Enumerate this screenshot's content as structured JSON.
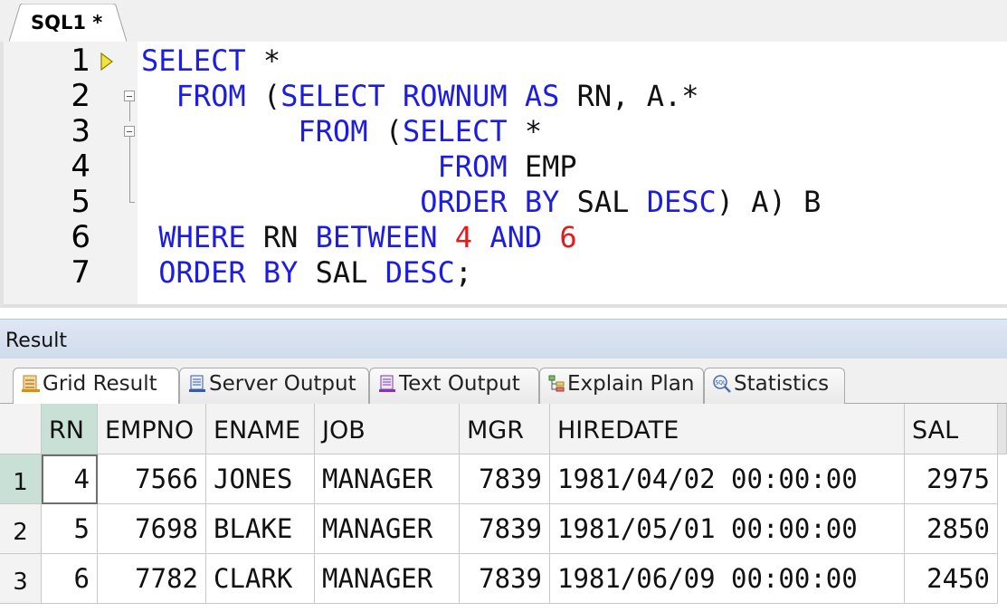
{
  "editor_tab": {
    "label": "SQL1 *"
  },
  "editor": {
    "line_numbers": [
      "1",
      "2",
      "3",
      "4",
      "5",
      "6",
      "7"
    ],
    "lines": [
      [
        {
          "t": "SELECT",
          "c": "kw"
        },
        {
          "t": " *",
          "c": "plain"
        }
      ],
      [
        {
          "t": "  FROM",
          "c": "kw"
        },
        {
          "t": " (",
          "c": "plain"
        },
        {
          "t": "SELECT ROWNUM AS",
          "c": "kw"
        },
        {
          "t": " RN, A.*",
          "c": "plain"
        }
      ],
      [
        {
          "t": "         FROM",
          "c": "kw"
        },
        {
          "t": " (",
          "c": "plain"
        },
        {
          "t": "SELECT",
          "c": "kw"
        },
        {
          "t": " *",
          "c": "plain"
        }
      ],
      [
        {
          "t": "                 FROM",
          "c": "kw"
        },
        {
          "t": " EMP",
          "c": "plain"
        }
      ],
      [
        {
          "t": "                ORDER BY",
          "c": "kw"
        },
        {
          "t": " SAL ",
          "c": "plain"
        },
        {
          "t": "DESC",
          "c": "kw"
        },
        {
          "t": ") A) B",
          "c": "plain"
        }
      ],
      [
        {
          "t": " WHERE",
          "c": "kw"
        },
        {
          "t": " RN ",
          "c": "plain"
        },
        {
          "t": "BETWEEN",
          "c": "kw"
        },
        {
          "t": " ",
          "c": "plain"
        },
        {
          "t": "4",
          "c": "num"
        },
        {
          "t": " ",
          "c": "plain"
        },
        {
          "t": "AND",
          "c": "kw"
        },
        {
          "t": " ",
          "c": "plain"
        },
        {
          "t": "6",
          "c": "num"
        }
      ],
      [
        {
          "t": " ORDER BY",
          "c": "kw"
        },
        {
          "t": " SAL ",
          "c": "plain"
        },
        {
          "t": "DESC",
          "c": "kw"
        },
        {
          "t": ";",
          "c": "plain"
        }
      ]
    ]
  },
  "result": {
    "title": "Result",
    "tabs": [
      {
        "label": "Grid Result",
        "icon": "grid-result-icon",
        "active": true
      },
      {
        "label": "Server Output",
        "icon": "server-output-icon",
        "active": false
      },
      {
        "label": "Text Output",
        "icon": "text-output-icon",
        "active": false
      },
      {
        "label": "Explain Plan",
        "icon": "explain-plan-icon",
        "active": false
      },
      {
        "label": "Statistics",
        "icon": "statistics-icon",
        "active": false
      }
    ],
    "columns": [
      "RN",
      "EMPNO",
      "ENAME",
      "JOB",
      "MGR",
      "HIREDATE",
      "SAL"
    ],
    "row_numbers": [
      "1",
      "2",
      "3"
    ],
    "rows": [
      [
        "4",
        "7566",
        "JONES",
        "MANAGER",
        "7839",
        "1981/04/02 00:00:00",
        "2975"
      ],
      [
        "5",
        "7698",
        "BLAKE",
        "MANAGER",
        "7839",
        "1981/05/01 00:00:00",
        "2850"
      ],
      [
        "6",
        "7782",
        "CLARK",
        "MANAGER",
        "7839",
        "1981/06/09 00:00:00",
        "2450"
      ]
    ]
  },
  "colors": {
    "keyword": "#1c1ce4",
    "number": "#e21b1b",
    "selected_header": "#c9e0d7"
  }
}
